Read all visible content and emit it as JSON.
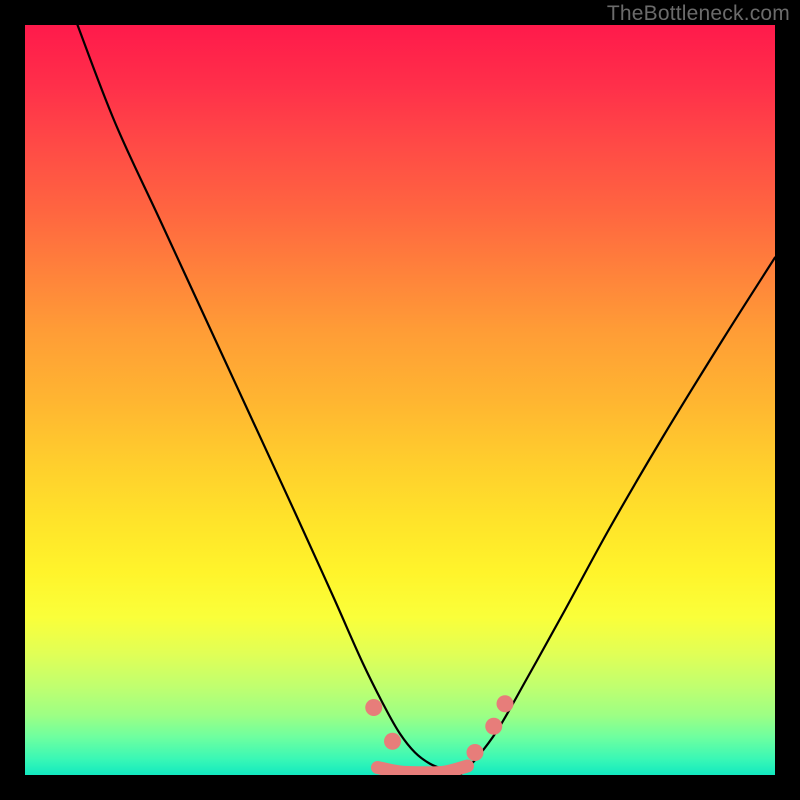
{
  "watermark": "TheBottleneck.com",
  "chart_data": {
    "type": "line",
    "title": "",
    "xlabel": "",
    "ylabel": "",
    "xlim": [
      0,
      100
    ],
    "ylim": [
      0,
      100
    ],
    "grid": false,
    "series": [
      {
        "name": "left-curve",
        "x": [
          7,
          12,
          18,
          24,
          30,
          36,
          41,
          45,
          48,
          50,
          52,
          54,
          56,
          58
        ],
        "values": [
          100,
          87,
          74,
          61,
          48,
          35,
          24,
          15,
          9,
          5.5,
          3,
          1.5,
          0.7,
          0
        ]
      },
      {
        "name": "right-curve",
        "x": [
          58,
          60,
          63,
          67,
          72,
          78,
          85,
          93,
          100
        ],
        "values": [
          0,
          2,
          6,
          13,
          22,
          33,
          45,
          58,
          69
        ]
      },
      {
        "name": "valley-flat",
        "x": [
          47,
          58
        ],
        "values": [
          0.3,
          0.3
        ]
      }
    ],
    "markers": [
      {
        "name": "left-marker-1",
        "x": 46.5,
        "y": 9.0
      },
      {
        "name": "left-marker-2",
        "x": 49.0,
        "y": 4.5
      },
      {
        "name": "right-marker-1",
        "x": 60.0,
        "y": 3.0
      },
      {
        "name": "right-marker-2",
        "x": 62.5,
        "y": 6.5
      },
      {
        "name": "right-marker-3",
        "x": 64.0,
        "y": 9.5
      }
    ],
    "marker_stroke": {
      "name": "valley-stroke",
      "x": [
        47,
        50,
        53,
        56,
        59
      ],
      "values": [
        1.0,
        0.4,
        0.3,
        0.4,
        1.2
      ]
    },
    "colors": {
      "gradient_top": "#ff1a4b",
      "gradient_mid": "#ffd02c",
      "gradient_bottom": "#12e9c0",
      "curve": "#000000",
      "marker": "#e77d7a",
      "frame": "#000000",
      "watermark": "#6b6b6b"
    }
  }
}
